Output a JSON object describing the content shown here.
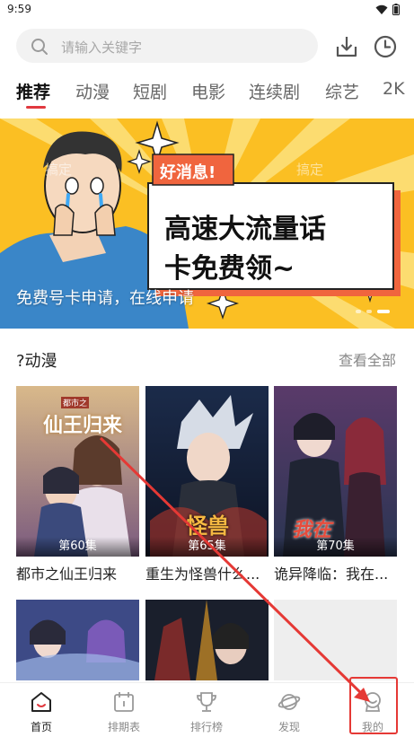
{
  "status_bar": {
    "time": "9:59"
  },
  "search": {
    "placeholder": "请输入关键字"
  },
  "tabs": [
    {
      "label": "推荐",
      "active": true
    },
    {
      "label": "动漫"
    },
    {
      "label": "短剧"
    },
    {
      "label": "电影"
    },
    {
      "label": "连续剧"
    },
    {
      "label": "综艺"
    },
    {
      "label": "2K"
    }
  ],
  "banner": {
    "badge": "好消息!",
    "headline_line1": "高速大流量话",
    "headline_line2": "卡免费领~",
    "caption": "免费号卡申请，在线申请",
    "watermark": "搞定",
    "active_slide": 3,
    "slide_count": 3
  },
  "section": {
    "title": "?动漫",
    "more_label": "查看全部"
  },
  "cards": [
    {
      "title": "都市之仙王归来",
      "episode": "第60集",
      "cover_text": "仙王归来",
      "cover_subtext": "都市之"
    },
    {
      "title": "重生为怪兽什么...",
      "episode": "第65集",
      "cover_text": "怪兽"
    },
    {
      "title": "诡异降临：我在...",
      "episode": "第70集",
      "cover_text": "我在"
    }
  ],
  "nav": [
    {
      "label": "首页",
      "icon": "home-icon",
      "active": true
    },
    {
      "label": "排期表",
      "icon": "calendar-icon"
    },
    {
      "label": "排行榜",
      "icon": "trophy-icon"
    },
    {
      "label": "发现",
      "icon": "planet-icon"
    },
    {
      "label": "我的",
      "icon": "user-face-icon"
    }
  ],
  "colors": {
    "accent": "#e0383e",
    "annotation": "#e53935",
    "banner_bg": "#fbbf23",
    "badge": "#f0653e"
  }
}
